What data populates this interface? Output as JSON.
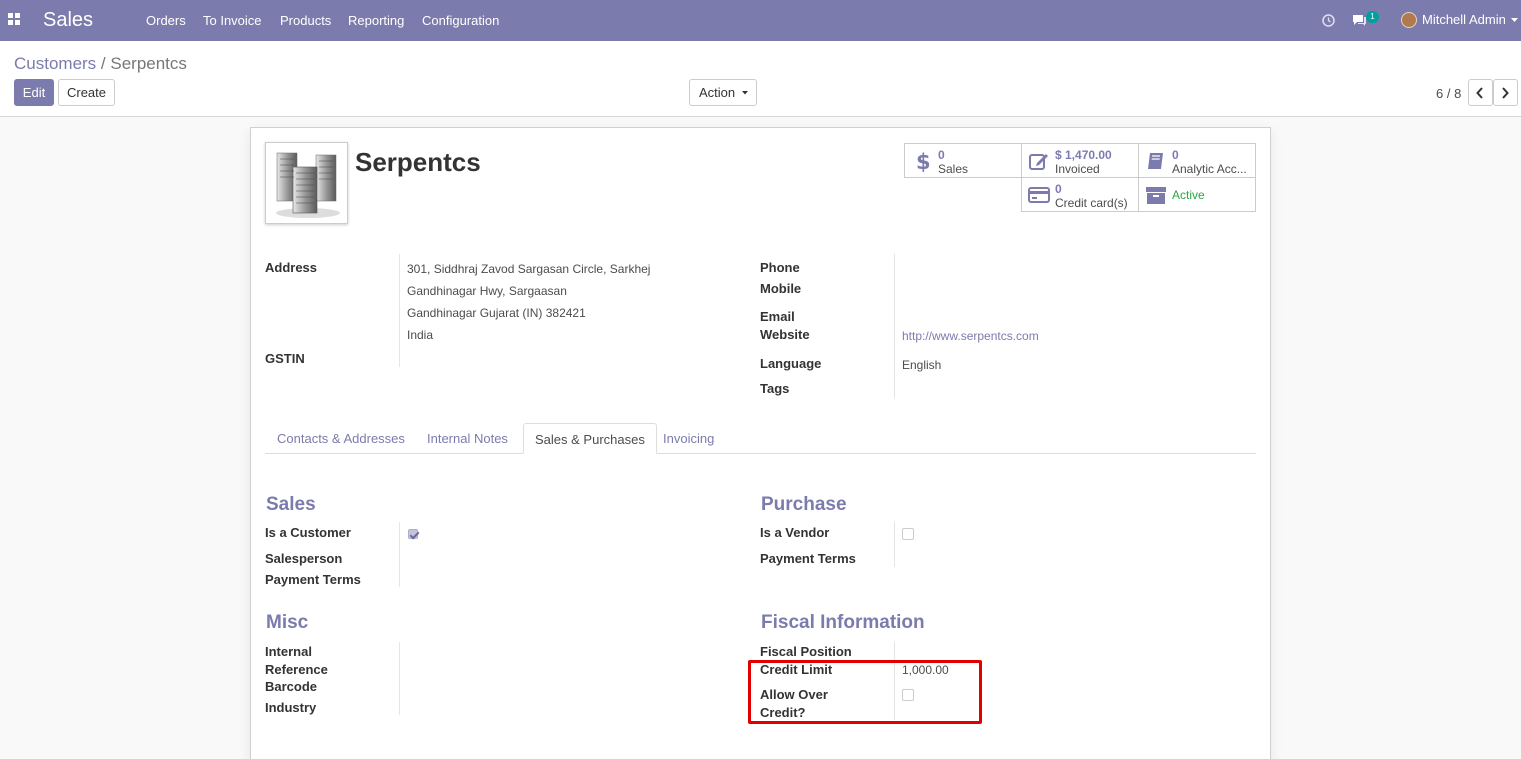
{
  "navbar": {
    "brand": "Sales",
    "menu": [
      "Orders",
      "To Invoice",
      "Products",
      "Reporting",
      "Configuration"
    ],
    "messages_count": "1",
    "user_name": "Mitchell Admin"
  },
  "control_panel": {
    "breadcrumb_parent": "Customers",
    "breadcrumb_separator": " / ",
    "breadcrumb_current": "Serpentcs",
    "edit_label": "Edit",
    "create_label": "Create",
    "action_label": "Action",
    "pager": "6 / 8"
  },
  "partner": {
    "name": "Serpentcs",
    "stats": {
      "sales_value": "0",
      "sales_label": "Sales",
      "invoiced_value": "$ 1,470.00",
      "invoiced_label": "Invoiced",
      "analytic_value": "0",
      "analytic_label": "Analytic Acc...",
      "credit_value": "0",
      "credit_label": "Credit card(s)",
      "active_label": "Active"
    },
    "left_fields": {
      "address_label": "Address",
      "address_lines": [
        "301, Siddhraj Zavod Sargasan Circle, Sarkhej",
        "Gandhinagar Hwy, Sargaasan",
        "Gandhinagar  Gujarat (IN)  382421",
        "India"
      ],
      "gstin_label": "GSTIN"
    },
    "right_fields": {
      "phone_label": "Phone",
      "mobile_label": "Mobile",
      "email_label": "Email",
      "website_label": "Website",
      "website_value": "http://www.serpentcs.com",
      "language_label": "Language",
      "language_value": "English",
      "tags_label": "Tags"
    }
  },
  "tabs": [
    "Contacts & Addresses",
    "Internal Notes",
    "Sales & Purchases",
    "Invoicing"
  ],
  "active_tab": "Sales & Purchases",
  "sales_section": {
    "title": "Sales",
    "is_customer_label": "Is a Customer",
    "is_customer": true,
    "salesperson_label": "Salesperson",
    "payment_terms_label": "Payment Terms"
  },
  "purchase_section": {
    "title": "Purchase",
    "is_vendor_label": "Is a Vendor",
    "is_vendor": false,
    "payment_terms_label": "Payment Terms"
  },
  "misc_section": {
    "title": "Misc",
    "internal_label_1": "Internal",
    "internal_label_2": "Reference",
    "barcode_label": "Barcode",
    "industry_label": "Industry"
  },
  "fiscal_section": {
    "title": "Fiscal Information",
    "fiscal_position_label": "Fiscal Position",
    "credit_limit_label": "Credit Limit",
    "credit_limit_value": "1,000.00",
    "allow_over_label_1": "Allow Over",
    "allow_over_label_2": "Credit?",
    "allow_over": false
  },
  "colors": {
    "brand": "#7c7bad",
    "active_green": "#28a745",
    "highlight_red": "#e00000",
    "badge_teal": "#00a09d"
  }
}
